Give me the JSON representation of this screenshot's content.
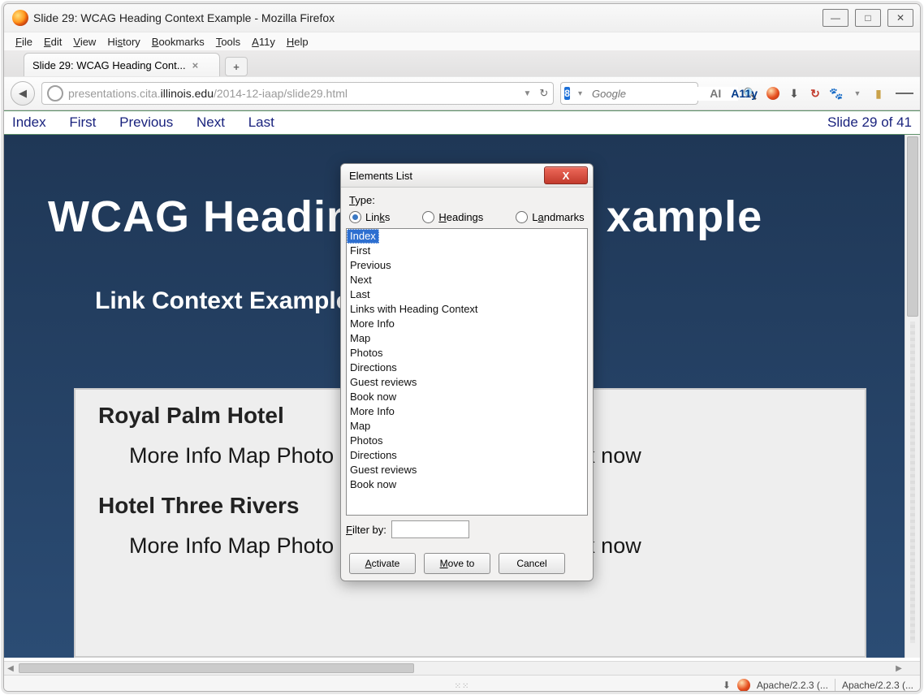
{
  "window": {
    "title": "Slide 29: WCAG Heading Context Example - Mozilla Firefox"
  },
  "menus": {
    "file": "File",
    "edit": "Edit",
    "view": "View",
    "history": "History",
    "bookmarks": "Bookmarks",
    "tools": "Tools",
    "a11y": "A11y",
    "help": "Help"
  },
  "tab": {
    "title": "Slide 29: WCAG Heading Cont..."
  },
  "url": {
    "pre": "presentations.cita.",
    "bold": "illinois.edu",
    "post": "/2014-12-iaap/slide29.html"
  },
  "search": {
    "engine": "8",
    "placeholder": "Google"
  },
  "toolbar": {
    "ai": "AI",
    "a11y": "A11y"
  },
  "pagenav": {
    "index": "Index",
    "first": "First",
    "previous": "Previous",
    "next": "Next",
    "last": "Last",
    "counter": "Slide 29 of 41"
  },
  "slide": {
    "h1": "WCAG Heading",
    "h1b": "xample",
    "h2": "Link Context Example",
    "hotel1": "Royal Palm Hotel",
    "links1a": "More Info Map Photo",
    "links1b": "Book now",
    "hotel2": "Hotel Three Rivers",
    "links2a": "More Info Map Photo",
    "links2b": "Book now"
  },
  "dialog": {
    "title": "Elements List",
    "type_label": "Type:",
    "links": "Links",
    "headings": "Headings",
    "landmarks": "Landmarks",
    "items": [
      "Index",
      "First",
      "Previous",
      "Next",
      "Last",
      "Links with Heading Context",
      "More Info",
      "Map",
      "Photos",
      "Directions",
      "Guest reviews",
      "Book now",
      "More Info",
      "Map",
      "Photos",
      "Directions",
      "Guest reviews",
      "Book now"
    ],
    "filter": "Filter by:",
    "activate": "Activate",
    "moveto": "Move to",
    "cancel": "Cancel"
  },
  "status": {
    "s1": "Apache/2.2.3 (...",
    "s2": "Apache/2.2.3 (..."
  }
}
